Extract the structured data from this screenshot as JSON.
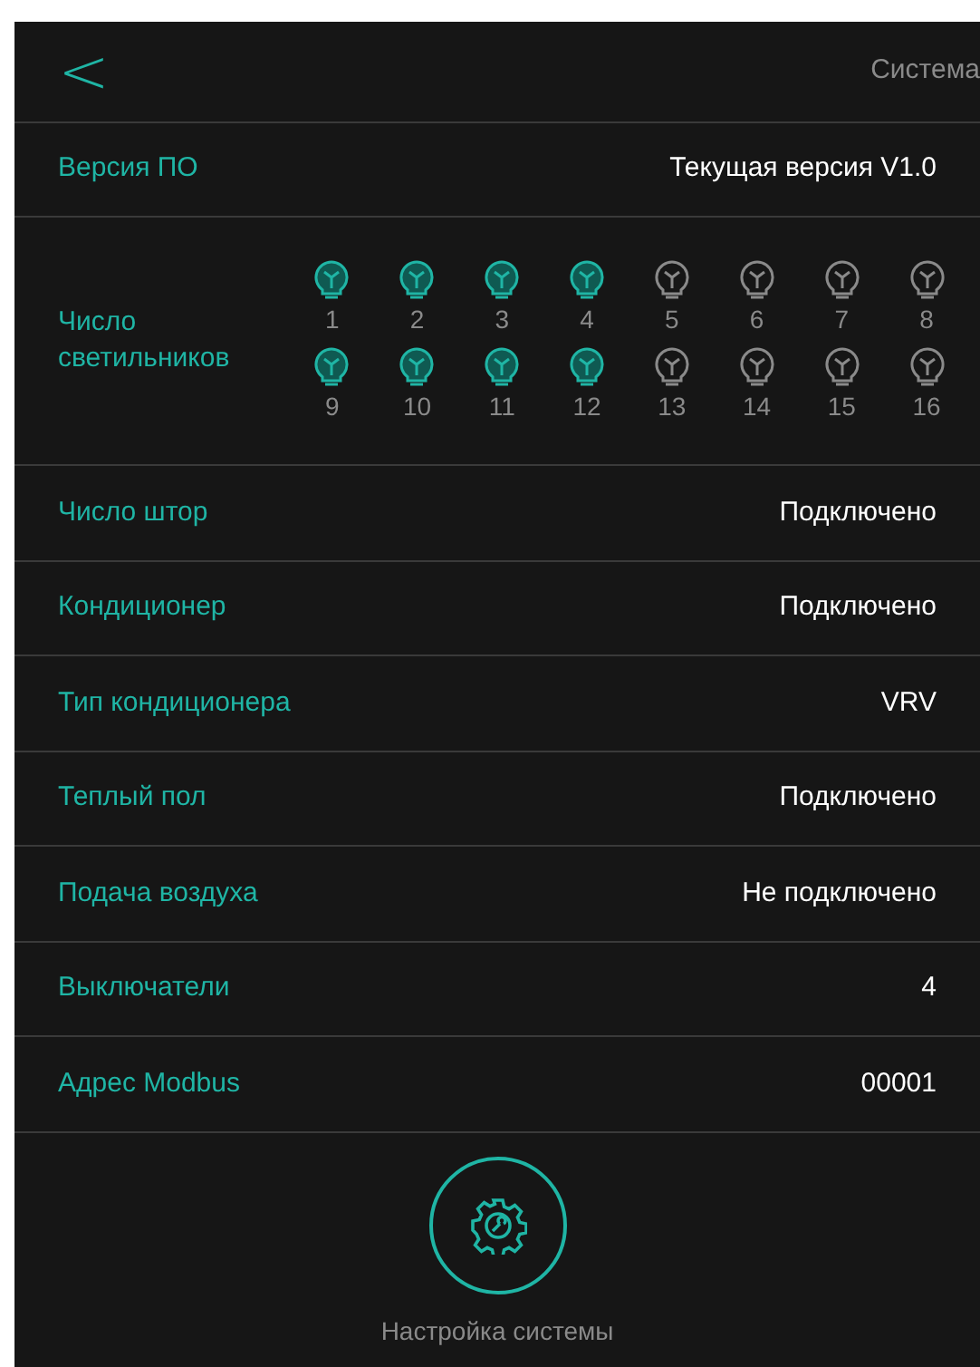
{
  "header": {
    "back": "<",
    "title": "Система"
  },
  "version": {
    "label": "Версия ПО",
    "value": "Текущая версия V1.0"
  },
  "lights": {
    "label": "Число светильников",
    "items": [
      {
        "number": "1",
        "on": true
      },
      {
        "number": "2",
        "on": true
      },
      {
        "number": "3",
        "on": true
      },
      {
        "number": "4",
        "on": true
      },
      {
        "number": "5",
        "on": false
      },
      {
        "number": "6",
        "on": false
      },
      {
        "number": "7",
        "on": false
      },
      {
        "number": "8",
        "on": false
      },
      {
        "number": "9",
        "on": true
      },
      {
        "number": "10",
        "on": true
      },
      {
        "number": "11",
        "on": true
      },
      {
        "number": "12",
        "on": true
      },
      {
        "number": "13",
        "on": false
      },
      {
        "number": "14",
        "on": false
      },
      {
        "number": "15",
        "on": false
      },
      {
        "number": "16",
        "on": false
      }
    ]
  },
  "settings": [
    {
      "label": "Число штор",
      "value": "Подключено"
    },
    {
      "label": "Кондиционер",
      "value": "Подключено"
    },
    {
      "label": "Тип кондиционера",
      "value": "VRV"
    },
    {
      "label": "Теплый пол",
      "value": "Подключено"
    },
    {
      "label": "Подача воздуха",
      "value": "Не подключено"
    },
    {
      "label": "Выключатели",
      "value": "4"
    },
    {
      "label": "Адрес Modbus",
      "value": "00001"
    }
  ],
  "system_button": {
    "label": "Настройка системы"
  }
}
